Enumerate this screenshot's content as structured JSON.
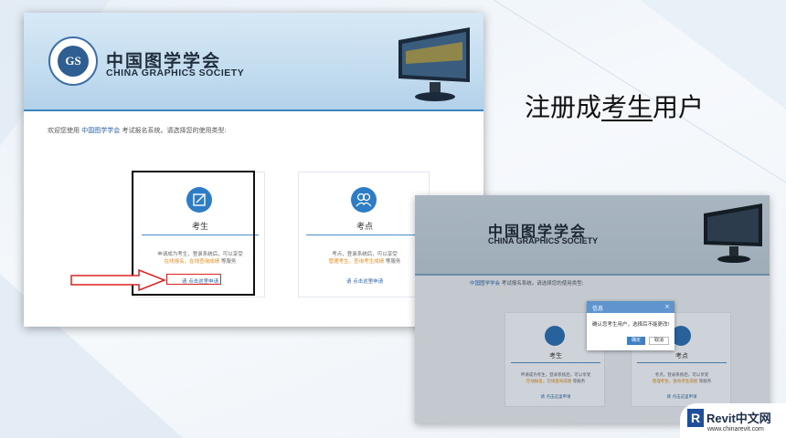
{
  "slide": {
    "heading_pre": "注册成",
    "heading_underlined": "考生",
    "heading_post": "用户"
  },
  "main_screenshot": {
    "logo_letters": "GS",
    "org_name_cn": "中国图学学会",
    "org_name_en": "CHINA GRAPHICS SOCIETY",
    "welcome_pre": "欢迎您使用 ",
    "welcome_org": "中国图学学会",
    "welcome_post": " 考试报名系统。请选择您的使用类型:",
    "cards": [
      {
        "icon": "edit-icon",
        "title": "考生",
        "desc_line1": "申请成为考生，登录系统后，可以享受",
        "desc_highlight": "在线报名，在线查询成绩",
        "desc_tail": " 等服务",
        "apply_label": "请 点击这里申请"
      },
      {
        "icon": "users-icon",
        "title": "考点",
        "desc_line1": "考点，登录系统后，可以享受",
        "desc_highlight": "管理考生，查询考生成绩",
        "desc_tail": " 等服务",
        "apply_label": "请 点击这里申请"
      }
    ]
  },
  "second_screenshot": {
    "org_name_cn": "中国图学学会",
    "org_name_en": "CHINA GRAPHICS SOCIETY",
    "welcome_org": "中国图学学会",
    "welcome_post": " 考试报名系统。请选择您的使用类型:",
    "cards": [
      {
        "title": "考生",
        "desc_line1": "申请成为考生，登录系统后，可以享受",
        "desc_highlight": "在线报名，在线查询成绩",
        "desc_tail": " 等服务",
        "apply_label": "请 点击这里申请"
      },
      {
        "title": "考点",
        "desc_line1": "考点，登录系统后，可以享受",
        "desc_highlight": "管理考生，查询考生成绩",
        "desc_tail": " 等服务",
        "apply_label": "请 点击这里申请"
      }
    ],
    "dialog": {
      "title": "信息",
      "close": "×",
      "message": "确认您考生用户，选择后不能更改!",
      "ok_label": "确定",
      "cancel_label": "取消"
    }
  },
  "watermark": {
    "brand": "Revit中文网",
    "url": "www.chinarevit.com"
  },
  "colors": {
    "accent": "#2d7cc6",
    "highlight_orange": "#e58b1d",
    "annotation_red": "#dd2222"
  }
}
